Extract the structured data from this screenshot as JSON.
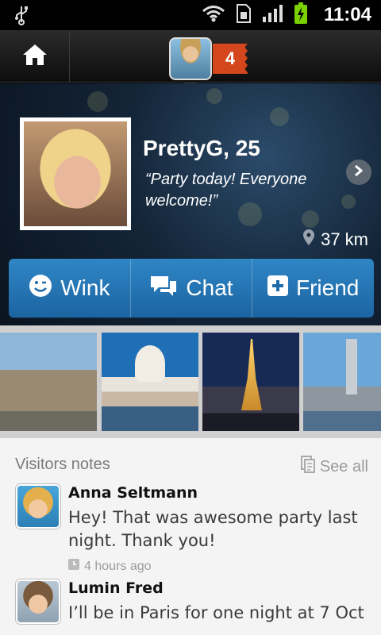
{
  "status_bar": {
    "time": "11:04",
    "icons": [
      "usb-icon",
      "wifi-icon",
      "sim-icon",
      "signal-icon",
      "battery-charging-icon"
    ]
  },
  "nav": {
    "notification_count": "4",
    "icons": [
      "home-icon",
      "avatar"
    ]
  },
  "profile": {
    "name_age": "PrettyG, 25",
    "status": "“Party today! Everyone welcome!”",
    "distance": "37 km"
  },
  "actions": [
    {
      "label": "Wink",
      "icon": "smiley-icon"
    },
    {
      "label": "Chat",
      "icon": "chat-bubbles-icon"
    },
    {
      "label": "Friend",
      "icon": "plus-square-icon"
    }
  ],
  "visitors_notes": {
    "title": "Visitors notes",
    "see_all": "See all",
    "notes": [
      {
        "name": "Anna Seltmann",
        "text": "Hey! That was awesome party last night. Thank you!",
        "time": "4 hours ago"
      },
      {
        "name": "Lumin Fred",
        "text": "I’ll be in Paris for one night at 7 Oct"
      }
    ]
  },
  "colors": {
    "accent_blue": "#2f86c5",
    "badge_orange": "#d4461c",
    "battery_green": "#7bd000"
  }
}
